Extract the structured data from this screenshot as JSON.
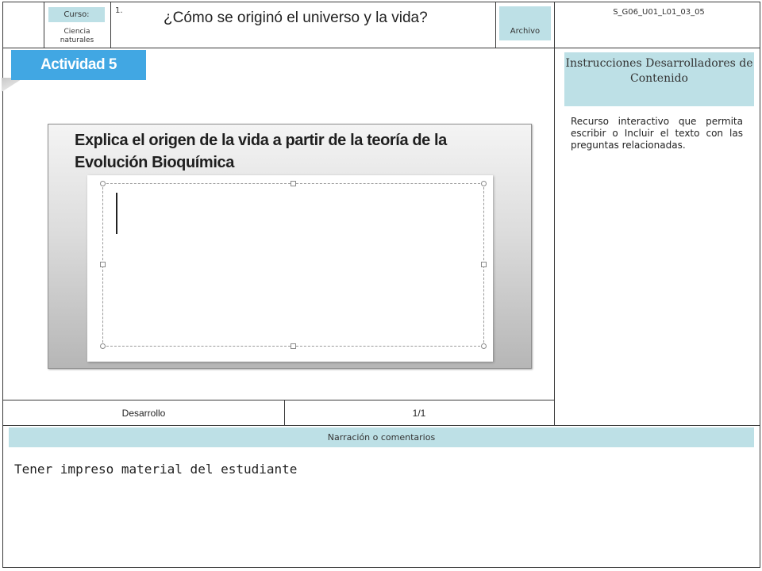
{
  "header": {
    "curso_label": "Curso:",
    "curso_value": "Ciencia naturales",
    "lesson_number": "1.",
    "title": "¿Cómo se originó el universo y la vida?",
    "archivo_label": "Archivo",
    "code": "S_G06_U01_L01_03_05"
  },
  "activity": {
    "tab_label": "Actividad 5",
    "prompt": "Explica el origen de la vida a partir de la teoría de la  Evolución Bioquímica"
  },
  "instructions": {
    "heading": "Instrucciones Desarrolladores de Contenido",
    "text": "Recurso interactivo que permita escribir o Incluir el texto con las preguntas relacionadas."
  },
  "footer": {
    "section": "Desarrollo",
    "page": "1/1"
  },
  "narration": {
    "label": "Narración o comentarios",
    "text": "Tener impreso material del estudiante"
  },
  "colors": {
    "accent_blue": "#41a7e3",
    "label_bg": "#bde0e6"
  }
}
